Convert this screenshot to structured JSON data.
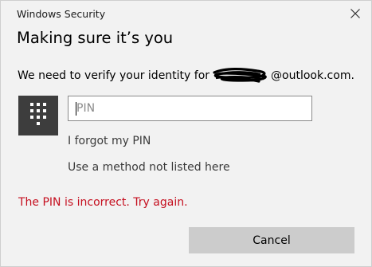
{
  "window": {
    "app_title": "Windows Security",
    "close_icon": "close-icon"
  },
  "main": {
    "heading": "Making sure it’s you",
    "verify_prefix": "We need to verify your identity for",
    "email_suffix": "@outlook.com.",
    "keypad_icon": "keypad-icon",
    "pin_placeholder": "PIN",
    "pin_value": "",
    "forgot_pin_link": "I forgot my PIN",
    "other_method_link": "Use a method not listed here",
    "error_message": "The PIN is incorrect. Try again.",
    "cancel_label": "Cancel"
  },
  "colors": {
    "background": "#f2f2f2",
    "keypad_tile": "#3d3d3d",
    "error": "#c50f1f",
    "cancel_button": "#cccccc"
  }
}
